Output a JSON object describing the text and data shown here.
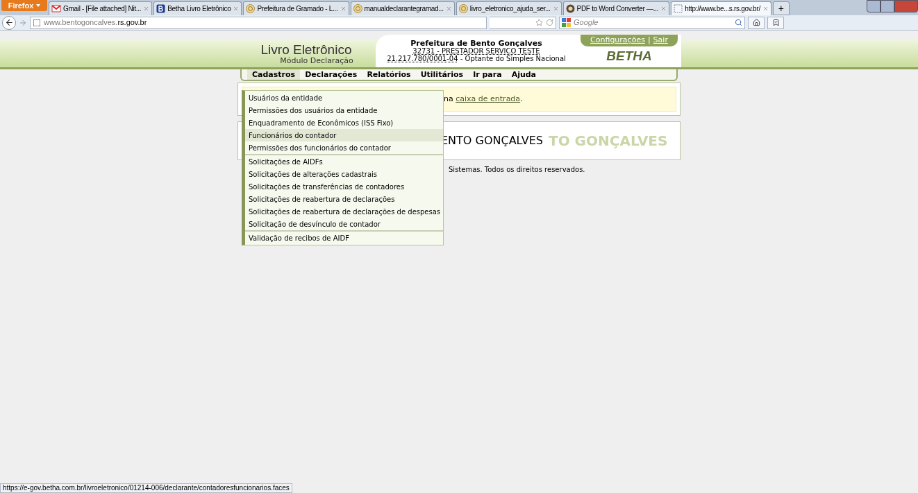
{
  "browser": {
    "app_button": "Firefox",
    "tabs": [
      {
        "title": "Gmail - [File attached] Nit...",
        "kind": "gmail",
        "selected": false
      },
      {
        "title": "Betha Livro Eletrônico",
        "kind": "betha",
        "selected": false
      },
      {
        "title": "Prefeitura de Gramado - L...",
        "kind": "globe",
        "selected": false
      },
      {
        "title": "manualdeclarantegramad...",
        "kind": "globe",
        "selected": false
      },
      {
        "title": "livro_eletronico_ajuda_ser...",
        "kind": "globe",
        "selected": false
      },
      {
        "title": "PDF to Word Converter —...",
        "kind": "pdf",
        "selected": false
      },
      {
        "title": "http://www.be...s.rs.gov.br/",
        "kind": "blank",
        "selected": true
      }
    ],
    "new_tab": "+",
    "address_host": "www.bentogoncalves.",
    "address_domain": "rs.gov.br",
    "search_placeholder": "Google",
    "status_url": "https://e-gov.betha.com.br/livroeletronico/01214-006/declarante/contadoresfuncionarios.faces"
  },
  "header": {
    "app_title": "Livro Eletrônico",
    "module": "Módulo Declaração",
    "entity": "Prefeitura de Bento Gonçalves",
    "provider": "32731 - PRESTADOR SERVICO TESTE",
    "cnpj": "21.217.780/0001-04",
    "regime": " - Optante do Simples Nacional",
    "settings_link": "Configurações",
    "separator": "|",
    "logout_link": "Sair",
    "brand": "BETHA"
  },
  "menu": [
    {
      "label": "Cadastros",
      "selected": true
    },
    {
      "label": "Declarações",
      "selected": false
    },
    {
      "label": "Relatórios",
      "selected": false
    },
    {
      "label": "Utilitários",
      "selected": false
    },
    {
      "label": "Ir para",
      "selected": false
    },
    {
      "label": "Ajuda",
      "selected": false
    }
  ],
  "dropdown": [
    [
      {
        "label": "Usuários da entidade",
        "selected": false
      },
      {
        "label": "Permissões dos usuários da entidade",
        "selected": false
      },
      {
        "label": "Enquadramento de Econômicos (ISS Fixo)",
        "selected": false
      },
      {
        "label": "Funcionários do contador",
        "selected": true
      },
      {
        "label": "Permissões dos funcionários do contador",
        "selected": false
      }
    ],
    [
      {
        "label": "Solicitações de AIDFs",
        "selected": false
      },
      {
        "label": "Solicitações de alterações cadastrais",
        "selected": false
      },
      {
        "label": "Solicitações de transferências de contadores",
        "selected": false
      },
      {
        "label": "Solicitações de reabertura de declarações",
        "selected": false
      },
      {
        "label": "Solicitações de reabertura de declarações de despesas",
        "selected": false
      },
      {
        "label": "Solicitação de desvínculo de contador",
        "selected": false
      }
    ],
    [
      {
        "label": "Validação de recibos de AIDF",
        "selected": false
      }
    ]
  ],
  "notice": {
    "text": "na ",
    "link": "caixa de entrada",
    "end": "."
  },
  "welcome": {
    "title": "ENTO GONÇALVES",
    "background_text": "TO GONÇALVES"
  },
  "footer": "Sistemas. Todos os direitos reservados."
}
